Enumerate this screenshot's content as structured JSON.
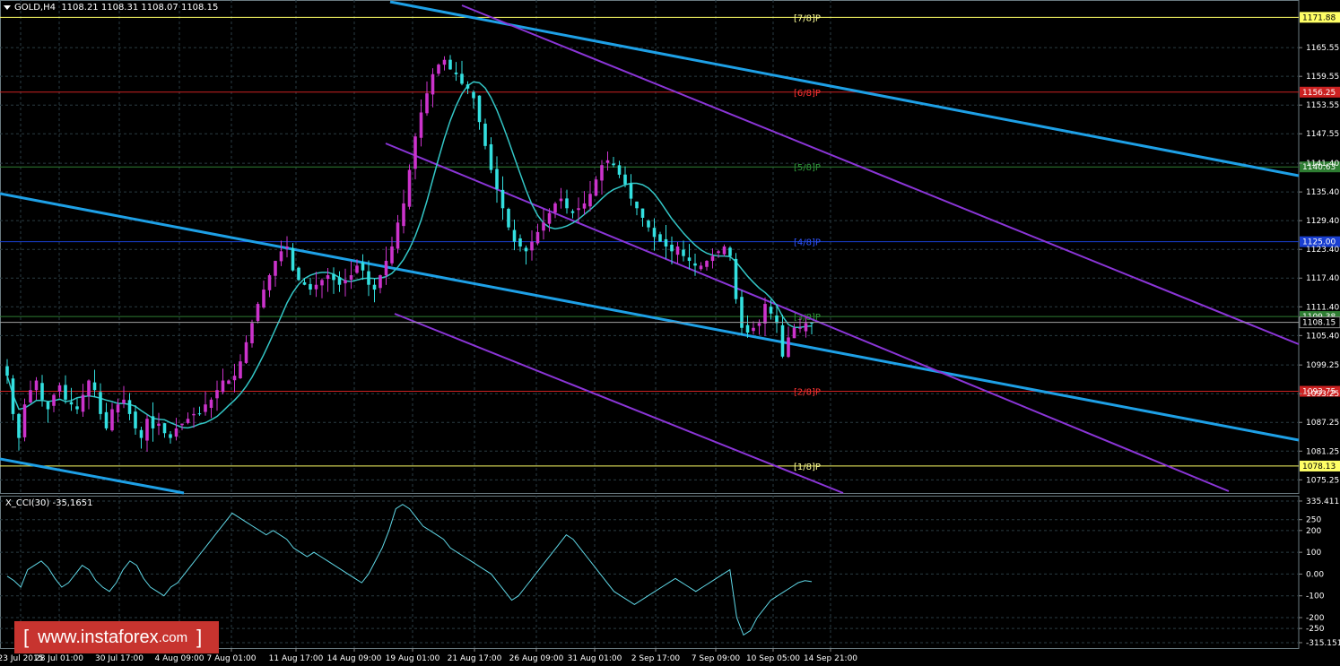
{
  "header": {
    "symbol": "GOLD,H4",
    "open": "1108.21",
    "high": "1108.31",
    "low": "1108.07",
    "close": "1108.15"
  },
  "indicator": {
    "label": "X_CCI(30) -35,1651"
  },
  "logo": {
    "text": "www.instaforex",
    "domain": ".com",
    "bracket_left": "[",
    "bracket_right": "]"
  },
  "colors": {
    "background": "#000000",
    "grid": "#2a3c43",
    "bull_candle": "#cc33cc",
    "bear_candle": "#33e0e0",
    "ma_line": "#33c6c6",
    "channel_blue": "#1ea0e6",
    "channel_purple": "#8a35d6",
    "cci_line": "#5fd7e6",
    "price_line": "#a0a0a0",
    "axis_text": "#ffffff"
  },
  "chart_data": {
    "type": "candlestick",
    "price_axis_ticks": [
      "1165.55",
      "1159.55",
      "1153.55",
      "1147.55",
      "1141.40",
      "1135.40",
      "1129.40",
      "1123.40",
      "1117.40",
      "1111.40",
      "1105.40",
      "1099.25",
      "1093.25",
      "1087.25",
      "1081.25",
      "1075.25"
    ],
    "time_axis_ticks": [
      "23 Jul 2015",
      "28 Jul 01:00",
      "30 Jul 17:00",
      "4 Aug 09:00",
      "7 Aug 01:00",
      "11 Aug 17:00",
      "14 Aug 09:00",
      "19 Aug 01:00",
      "21 Aug 17:00",
      "26 Aug 09:00",
      "31 Aug 01:00",
      "2 Sep 17:00",
      "7 Sep 09:00",
      "10 Sep 05:00",
      "14 Sep 21:00"
    ],
    "current_price": "1108.15",
    "murrey_levels": [
      {
        "label": "[7/8]P",
        "price": "1171.88",
        "color": "#ffff66",
        "text_color": "#ffff99"
      },
      {
        "label": "[6/8]P",
        "price": "1156.25",
        "color": "#cc2222",
        "text_color": "#ff3333"
      },
      {
        "label": "[5/8]P",
        "price": "1140.63",
        "color": "#2e7d32",
        "text_color": "#2e9a3a"
      },
      {
        "label": "[4/8]P",
        "price": "1125.00",
        "color": "#1a3fd1",
        "text_color": "#2f55ff"
      },
      {
        "label": "[3/8]P",
        "price": "1109.38",
        "color": "#2e7d32",
        "text_color": "#2e9a3a"
      },
      {
        "label": "[2/8]P",
        "price": "1093.75",
        "color": "#cc2222",
        "text_color": "#ff3333"
      },
      {
        "label": "[1/8]P",
        "price": "1078.13",
        "color": "#ffff66",
        "text_color": "#ffff99"
      }
    ],
    "murrey_badge_text": [
      "1171.88",
      "1156.25",
      "1140.63",
      "1125.00",
      "1109.38",
      "1093.75",
      "1078.13"
    ],
    "close_series": [
      1097,
      1089,
      1084,
      1091,
      1094,
      1096,
      1092,
      1090,
      1093,
      1095,
      1092,
      1091,
      1090,
      1093,
      1096,
      1094,
      1089,
      1086,
      1090,
      1091,
      1092,
      1089,
      1086,
      1084,
      1088,
      1086,
      1087,
      1085,
      1084,
      1086,
      1087,
      1088,
      1089,
      1089,
      1091,
      1092,
      1094,
      1096,
      1096,
      1097,
      1100,
      1104,
      1108,
      1112,
      1115,
      1118,
      1121,
      1123,
      1124,
      1119,
      1117,
      1116,
      1115,
      1116,
      1117,
      1118,
      1117,
      1116,
      1117,
      1118,
      1120,
      1119,
      1116,
      1115,
      1118,
      1121,
      1124,
      1129,
      1133,
      1140,
      1147,
      1152,
      1156,
      1160,
      1162,
      1163,
      1161,
      1160,
      1158,
      1157,
      1155,
      1150,
      1145,
      1140,
      1136,
      1132,
      1128,
      1125,
      1124,
      1123,
      1125,
      1127,
      1129,
      1131,
      1133,
      1134,
      1132,
      1131,
      1132,
      1133,
      1135,
      1138,
      1141,
      1142,
      1141,
      1139,
      1137,
      1134,
      1132,
      1130,
      1128,
      1126,
      1125,
      1124,
      1123,
      1124,
      1122,
      1121,
      1120,
      1120,
      1121,
      1122,
      1123,
      1124,
      1122,
      1113,
      1107,
      1106,
      1107,
      1108,
      1112,
      1110,
      1108,
      1101,
      1105,
      1107,
      1107,
      1108,
      1108
    ],
    "cci": {
      "axis_ticks": [
        "335.411",
        "250",
        "200",
        "100",
        "0.00",
        "-100",
        "-200",
        "-250",
        "-315.151"
      ],
      "values": [
        -10,
        -30,
        -60,
        20,
        40,
        60,
        30,
        -20,
        -60,
        -40,
        0,
        40,
        20,
        -30,
        -60,
        -80,
        -40,
        20,
        60,
        40,
        -20,
        -60,
        -80,
        -100,
        -60,
        -40,
        0,
        40,
        80,
        120,
        160,
        200,
        240,
        280,
        260,
        240,
        220,
        200,
        180,
        200,
        180,
        160,
        120,
        100,
        80,
        100,
        80,
        60,
        40,
        20,
        0,
        -20,
        -40,
        0,
        60,
        120,
        200,
        300,
        320,
        300,
        260,
        220,
        200,
        180,
        160,
        120,
        100,
        80,
        60,
        40,
        20,
        0,
        -40,
        -80,
        -120,
        -100,
        -60,
        -20,
        20,
        60,
        100,
        140,
        180,
        160,
        120,
        80,
        40,
        0,
        -40,
        -80,
        -100,
        -120,
        -140,
        -120,
        -100,
        -80,
        -60,
        -40,
        -20,
        -40,
        -60,
        -80,
        -60,
        -40,
        -20,
        0,
        20,
        -200,
        -280,
        -260,
        -200,
        -160,
        -120,
        -100,
        -80,
        -60,
        -40,
        -30,
        -35
      ]
    }
  }
}
